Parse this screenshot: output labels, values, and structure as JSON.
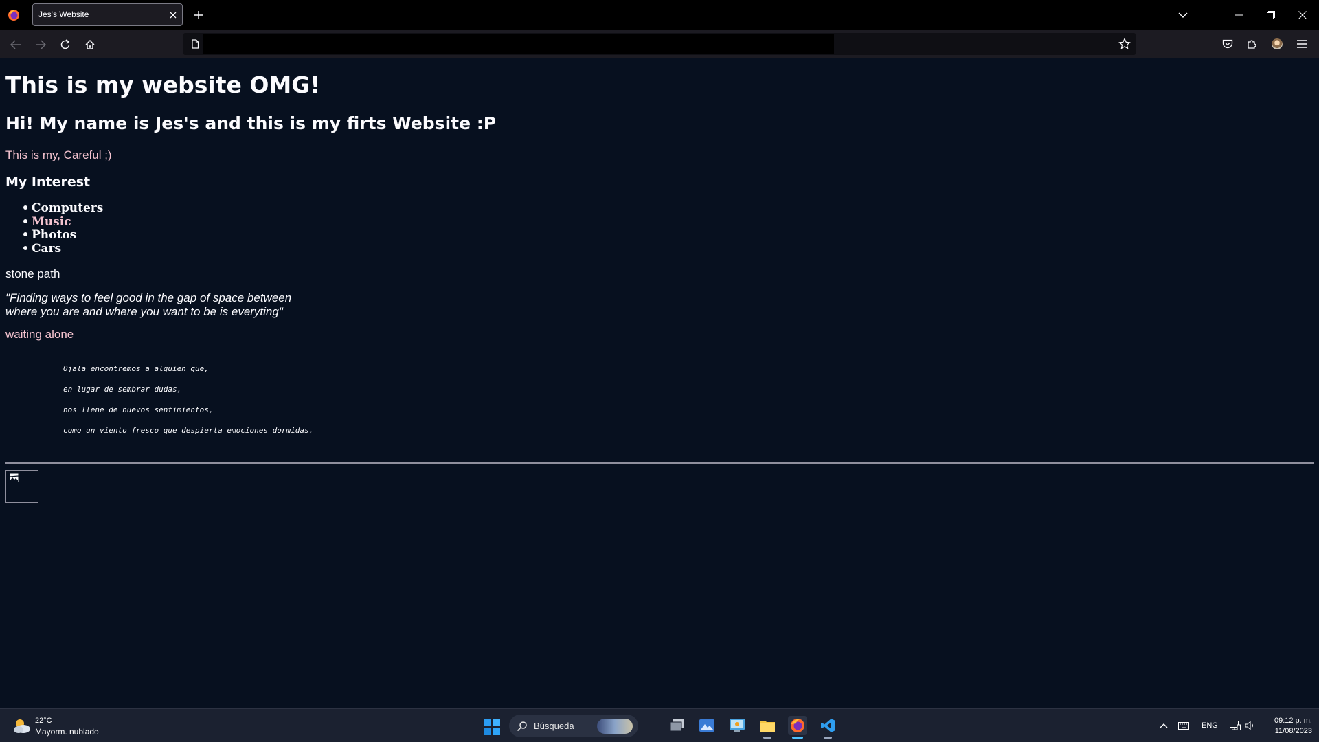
{
  "browser": {
    "tab_title": "Jes's Website",
    "url": ""
  },
  "page": {
    "h1": "This is my website OMG!",
    "h2": "Hi! My name is Jes's and this is my firts Website :P",
    "intro": "This is my, Careful ;)",
    "interest_heading": "My Interest",
    "interests": [
      "Computers",
      "Music",
      "Photos",
      "Cars"
    ],
    "stone_path": "stone path",
    "quote_line1": "\"Finding ways to feel good in the gap of space between",
    "quote_line2": "where you are and where you want to be is everyting\"",
    "waiting": "waiting alone",
    "poem": [
      "Ojala encontremos a alguien que,",
      "en lugar de sembrar dudas,",
      "nos llene de nuevos sentimientos,",
      "como un viento fresco que despierta emociones dormidas."
    ],
    "colors": {
      "background": "#07101f",
      "text": "#fbfbfe",
      "accent_pink": "#f4c3cf"
    }
  },
  "taskbar": {
    "weather_temp": "22°C",
    "weather_desc": "Mayorm. nublado",
    "search_placeholder": "Búsqueda",
    "language": "ENG",
    "time": "09:12 p. m.",
    "date": "11/08/2023"
  }
}
